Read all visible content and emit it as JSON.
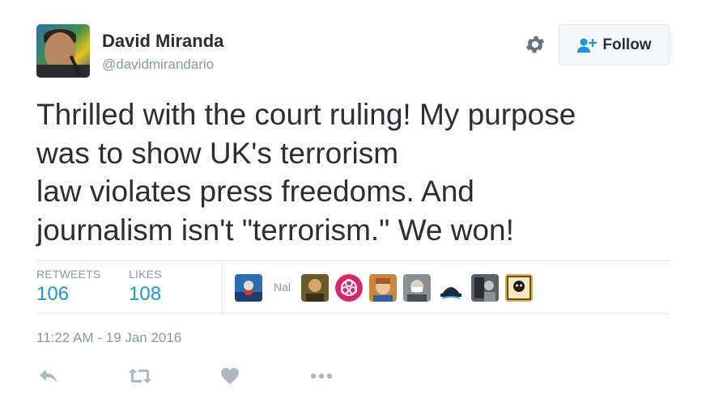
{
  "author": {
    "name": "David Miranda",
    "handle": "@davidmirandario"
  },
  "follow_button": {
    "label": "Follow"
  },
  "tweet": {
    "lines": [
      "Thrilled with the court ruling! My purpose",
      "was to show UK's terrorism",
      "law violates press freedoms. And",
      "journalism isn't \"terrorism.\" We won!"
    ]
  },
  "stats": {
    "retweets_label": "RETWEETS",
    "retweets_count": "106",
    "likes_label": "LIKES",
    "likes_count": "108"
  },
  "likers": {
    "truncated_name": "Nal",
    "avatar_colors": [
      "#2f6db3",
      "#6b5a2a",
      "#d8256c",
      "#c9863d",
      "#8a8f96",
      "#1c2b3a",
      "#5c6066",
      "#d6b34a"
    ]
  },
  "timestamp": "11:22 AM - 19 Jan 2016",
  "actions": {
    "reply_icon": "reply-icon",
    "retweet_icon": "retweet-icon",
    "like_icon": "heart-icon",
    "more_icon": "more-icon"
  },
  "colors": {
    "link": "#1b95e0",
    "muted": "#8899a6",
    "text": "#292f33",
    "border": "#e1e8ed",
    "icon": "#aab8c2"
  }
}
